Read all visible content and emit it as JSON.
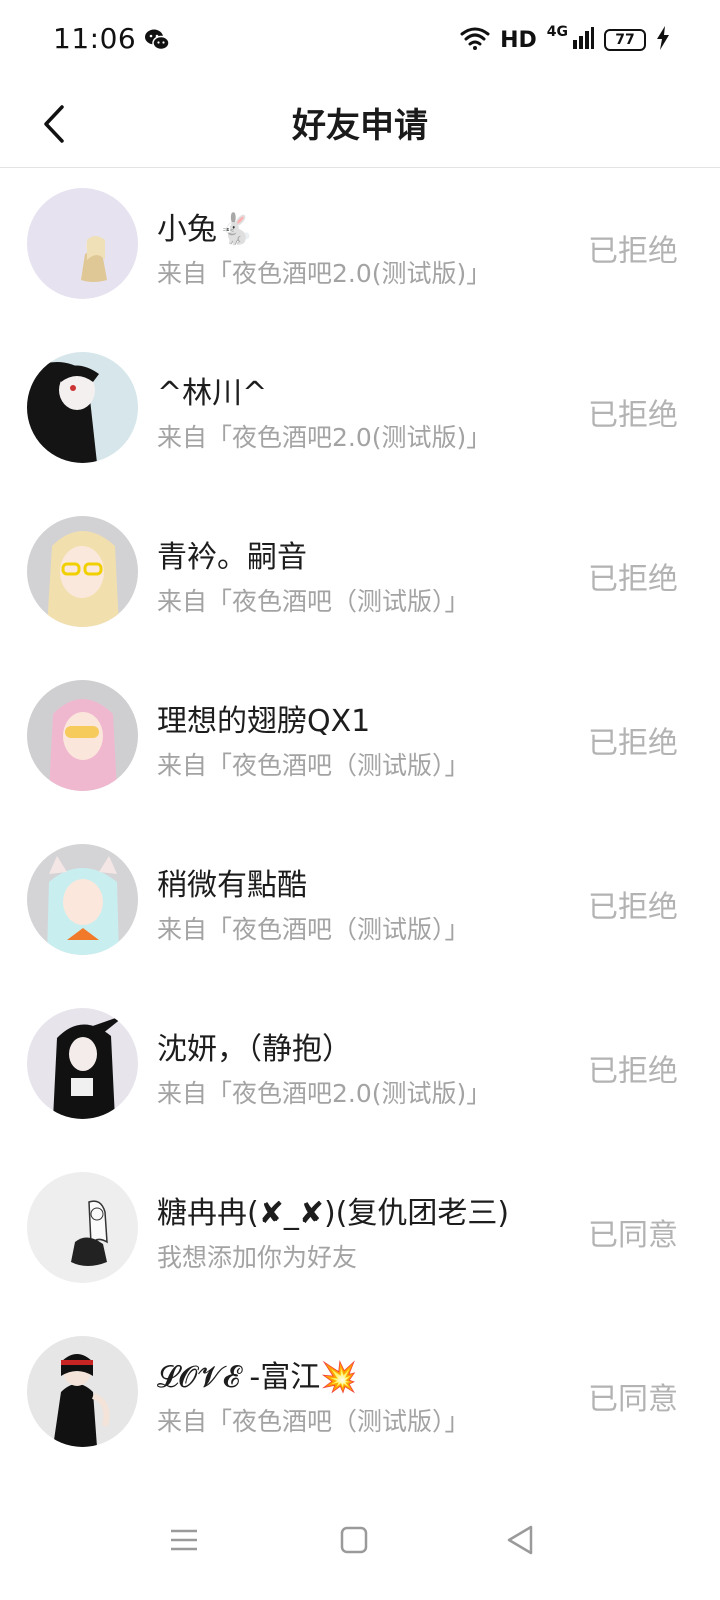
{
  "status_bar": {
    "time": "11:06",
    "hd": "HD",
    "network": "4G",
    "battery": "77"
  },
  "header": {
    "title": "好友申请"
  },
  "requests": [
    {
      "name": "小兔🐇",
      "source": "来自「夜色酒吧2.0(测试版)」",
      "status": "已拒绝"
    },
    {
      "name": "^林川^",
      "source": "来自「夜色酒吧2.0(测试版)」",
      "status": "已拒绝"
    },
    {
      "name": "青衿。嗣音",
      "source": "来自「夜色酒吧（测试版）」",
      "status": "已拒绝"
    },
    {
      "name": "理想的翅膀QX1",
      "source": "来自「夜色酒吧（测试版）」",
      "status": "已拒绝"
    },
    {
      "name": "稍微有點酷",
      "source": "来自「夜色酒吧（测试版）」",
      "status": "已拒绝"
    },
    {
      "name": "沈妍，（静抱）",
      "source": "来自「夜色酒吧2.0(测试版)」",
      "status": "已拒绝"
    },
    {
      "name": "糖冉冉(✘_✘)(复仇团老三)",
      "source": "我想添加你为好友",
      "status": "已同意"
    },
    {
      "name": "𝓛𝓞𝓥𝓔 -富江💥",
      "source": "来自「夜色酒吧（测试版）」",
      "status": "已同意"
    }
  ],
  "colors": {
    "status_text": "#b3b3b3",
    "source_text": "#a3a3a3",
    "name_text": "#1d1d1d"
  },
  "icons": {
    "back": "chevron-left-icon",
    "wechat": "wechat-icon",
    "wifi": "wifi-icon",
    "signal": "signal-icon",
    "battery": "battery-icon",
    "charging": "charging-icon",
    "nav_menu": "menu-icon",
    "nav_home": "home-square-icon",
    "nav_back": "back-triangle-icon"
  }
}
